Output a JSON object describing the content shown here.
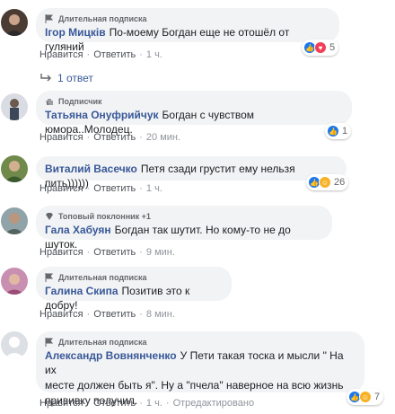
{
  "comments": [
    {
      "badge": "Длительная подписка",
      "badge_icon": "flag-icon",
      "author": "Ігор Мицків",
      "text": "По-моему Богдан еще не отошёл от гуляний",
      "like": "Нравится",
      "reply": "Ответить",
      "time": "1 ч.",
      "reactions": [
        "like",
        "love"
      ],
      "reaction_count": "5"
    },
    {
      "badge": "Подписчик",
      "badge_icon": "wave-icon",
      "author": "Татьяна Онуфрийчук",
      "text": "Богдан с чувством юмора..Молодец.",
      "like": "Нравится",
      "reply": "Ответить",
      "time": "20 мин.",
      "reactions": [
        "like"
      ],
      "reaction_count": "1"
    },
    {
      "badge": "",
      "author": "Виталий Васечко",
      "text": "Петя сзади грустит ему нельзя пить))))))",
      "like": "Нравится",
      "reply": "Ответить",
      "time": "1 ч.",
      "reactions": [
        "like",
        "haha"
      ],
      "reaction_count": "26"
    },
    {
      "badge": "Топовый поклонник +1",
      "badge_icon": "diamond-icon",
      "author": "Гала Хабуян",
      "text": "Богдан так шутит. Но кому-то не до шуток.",
      "like": "Нравится",
      "reply": "Ответить",
      "time": "9 мин.",
      "reactions": [],
      "reaction_count": ""
    },
    {
      "badge": "Длительная подписка",
      "badge_icon": "flag-icon",
      "author": "Галина Скипа",
      "text": "Позитив это к добру!",
      "like": "Нравится",
      "reply": "Ответить",
      "time": "8 мин.",
      "reactions": [],
      "reaction_count": ""
    },
    {
      "badge": "Длительная подписка",
      "badge_icon": "flag-icon",
      "author": "Александр Вовнянченко",
      "text_lines": [
        "У Пети такая тоска и мысли \" На их",
        "месте должен быть я\". Ну а \"пчела\" наверное на всю жизнь",
        "прививку получил."
      ],
      "like": "Нравится",
      "reply": "Ответить",
      "time": "1 ч.",
      "edited": "Отредактировано",
      "reactions": [
        "like",
        "haha"
      ],
      "reaction_count": "7"
    }
  ],
  "replies_label": "1 ответ",
  "separator": "·",
  "colors": {
    "author": "#385898",
    "bubble": "#f2f3f5",
    "like": "#1877f2",
    "love": "#f33e58",
    "haha": "#f7b125"
  }
}
